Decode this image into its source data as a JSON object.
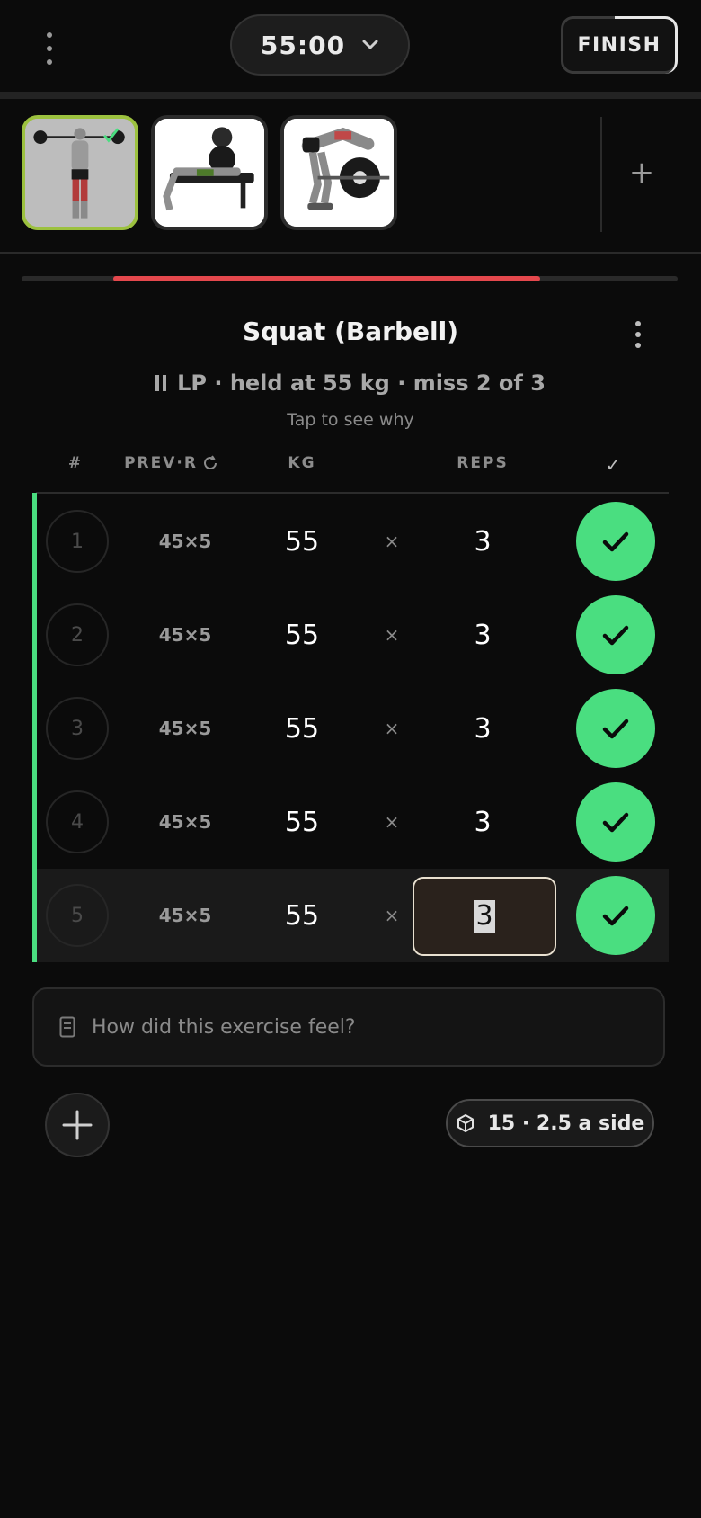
{
  "header": {
    "timer": "55:00",
    "finish_label": "FINISH"
  },
  "thumbnails": [
    {
      "name": "Squat (Barbell)",
      "selected": true,
      "completed": true
    },
    {
      "name": "Bench press",
      "selected": false,
      "completed": false
    },
    {
      "name": "Barbell row",
      "selected": false,
      "completed": false
    }
  ],
  "add_exercise_label": "+",
  "progress": {
    "start_fraction": 0.14,
    "end_fraction": 0.79,
    "color": "#e5484d"
  },
  "exercise": {
    "title": "Squat (Barbell)",
    "status_line": "LP · held at 55 kg · miss 2 of 3",
    "status_hint": "Tap to see why"
  },
  "table": {
    "headers": {
      "num": "#",
      "prev": "PREV·R",
      "kg": "KG",
      "reps": "REPS",
      "check": "✓"
    },
    "sets": [
      {
        "num": "1",
        "prev": "45×5",
        "kg": "55",
        "times": "×",
        "reps": "3",
        "done": true
      },
      {
        "num": "2",
        "prev": "45×5",
        "kg": "55",
        "times": "×",
        "reps": "3",
        "done": true
      },
      {
        "num": "3",
        "prev": "45×5",
        "kg": "55",
        "times": "×",
        "reps": "3",
        "done": true
      },
      {
        "num": "4",
        "prev": "45×5",
        "kg": "55",
        "times": "×",
        "reps": "3",
        "done": true
      },
      {
        "num": "5",
        "prev": "45×5",
        "kg": "55",
        "times": "×",
        "reps": "3",
        "done": true,
        "editing": true
      }
    ]
  },
  "notes": {
    "placeholder": "How did this exercise feel?"
  },
  "plates": {
    "label": "15 · 2.5 a side"
  },
  "colors": {
    "accent_green": "#4ade80",
    "selected_border": "#9cc13f",
    "background": "#0b0b0b"
  }
}
